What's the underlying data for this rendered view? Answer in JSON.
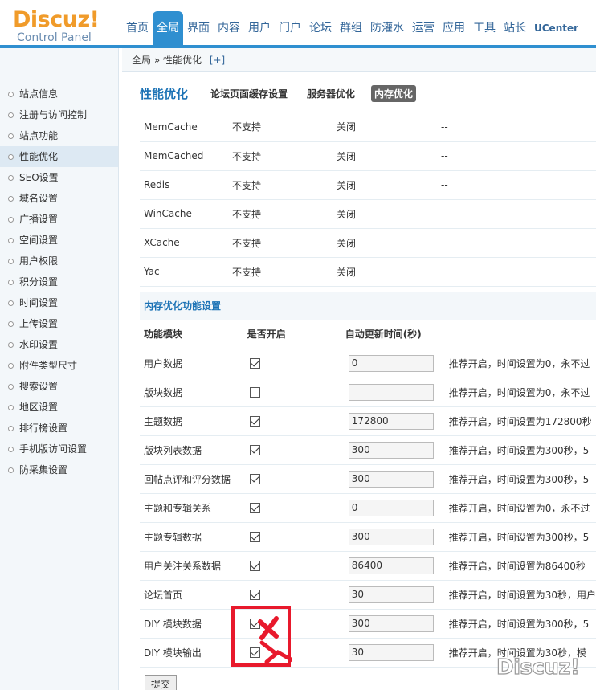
{
  "header": {
    "logo_main": "Discuz!",
    "logo_sub": "Control Panel",
    "nav": [
      "首页",
      "全局",
      "界面",
      "内容",
      "用户",
      "门户",
      "论坛",
      "群组",
      "防灌水",
      "运营",
      "应用",
      "工具",
      "站长",
      "UCenter"
    ],
    "active_nav_index": 1
  },
  "breadcrumb": {
    "text": "全局 » 性能优化",
    "add": "[+]"
  },
  "sidebar": {
    "items": [
      "站点信息",
      "注册与访问控制",
      "站点功能",
      "性能优化",
      "SEO设置",
      "域名设置",
      "广播设置",
      "空间设置",
      "用户权限",
      "积分设置",
      "时间设置",
      "上传设置",
      "水印设置",
      "附件类型尺寸",
      "搜索设置",
      "地区设置",
      "排行榜设置",
      "手机版访问设置",
      "防采集设置"
    ],
    "active_index": 3
  },
  "main": {
    "title": "性能优化",
    "tabs": [
      "论坛页面缓存设置",
      "服务器优化",
      "内存优化"
    ],
    "active_tab_index": 2,
    "cache_table": [
      {
        "name": "MemCache",
        "support": "不支持",
        "status": "关闭",
        "extra": "--"
      },
      {
        "name": "MemCached",
        "support": "不支持",
        "status": "关闭",
        "extra": "--"
      },
      {
        "name": "Redis",
        "support": "不支持",
        "status": "关闭",
        "extra": "--"
      },
      {
        "name": "WinCache",
        "support": "不支持",
        "status": "关闭",
        "extra": "--"
      },
      {
        "name": "XCache",
        "support": "不支持",
        "status": "关闭",
        "extra": "--"
      },
      {
        "name": "Yac",
        "support": "不支持",
        "status": "关闭",
        "extra": "--"
      }
    ],
    "section_title": "内存优化功能设置",
    "headers": [
      "功能模块",
      "是否开启",
      "自动更新时间(秒)"
    ],
    "rows": [
      {
        "module": "用户数据",
        "enabled": true,
        "time": "0",
        "tip": "推荐开启，时间设置为0，永不过"
      },
      {
        "module": "版块数据",
        "enabled": false,
        "time": "",
        "tip": "推荐开启，时间设置为0，永不过"
      },
      {
        "module": "主题数据",
        "enabled": true,
        "time": "172800",
        "tip": "推荐开启，时间设置为172800秒"
      },
      {
        "module": "版块列表数据",
        "enabled": true,
        "time": "300",
        "tip": "推荐开启，时间设置为300秒，5"
      },
      {
        "module": "回帖点评和评分数据",
        "enabled": true,
        "time": "300",
        "tip": "推荐开启，时间设置为300秒，5"
      },
      {
        "module": "主题和专辑关系",
        "enabled": true,
        "time": "0",
        "tip": "推荐开启，时间设置为0，永不过"
      },
      {
        "module": "主题专辑数据",
        "enabled": true,
        "time": "300",
        "tip": "推荐开启，时间设置为300秒，5"
      },
      {
        "module": "用户关注关系数据",
        "enabled": true,
        "time": "86400",
        "tip": "推荐开启，时间设置为86400秒"
      },
      {
        "module": "论坛首页",
        "enabled": true,
        "time": "30",
        "tip": "推荐开启，时间设置为30秒，用户"
      },
      {
        "module": "DIY 模块数据",
        "enabled": true,
        "time": "300",
        "tip": "推荐开启，时间设置为300秒，5"
      },
      {
        "module": "DIY 模块输出",
        "enabled": true,
        "time": "30",
        "tip": "推荐开启，时间设置为30秒，模"
      }
    ],
    "submit_label": "提交"
  },
  "watermark": "Discuz!",
  "colors": {
    "accent": "#2f8fd0",
    "logo": "#f09b2a",
    "annotation": "#e8192c"
  }
}
